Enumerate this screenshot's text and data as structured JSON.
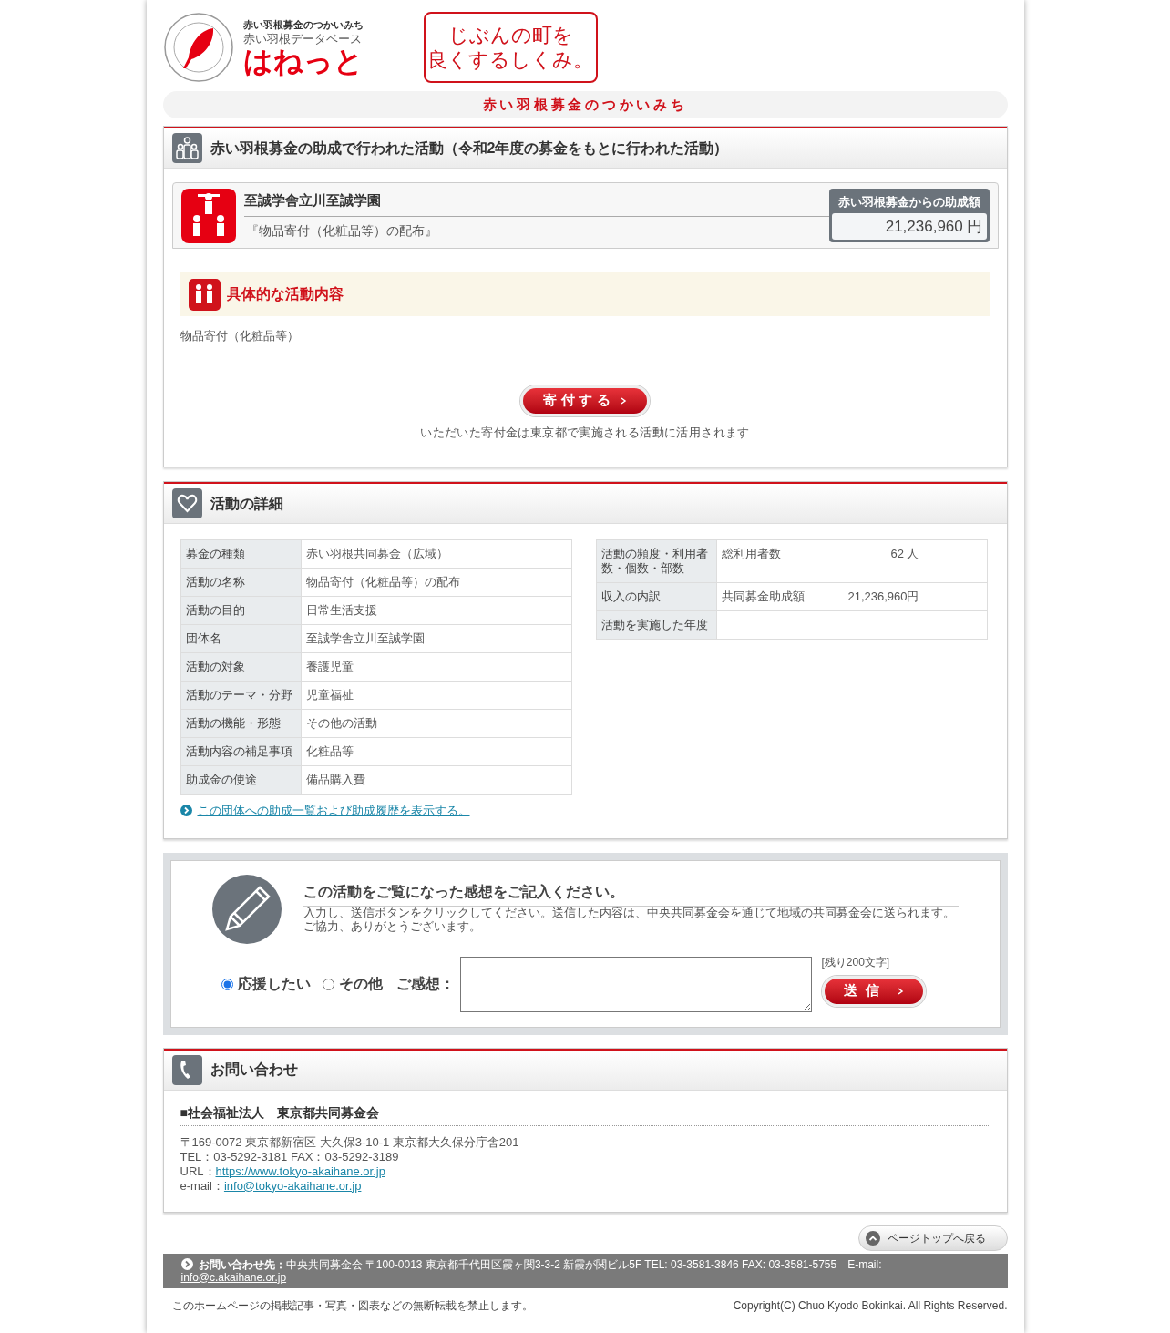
{
  "header": {
    "logo_caption": "赤い羽根募金のつかいみち",
    "logo_subtitle": "赤い羽根データベース",
    "logo_name": "はねっと",
    "slogan": [
      "じぶんの町を",
      "良くするしくみ。"
    ]
  },
  "banner": "赤い羽根募金のつかいみち",
  "activity": {
    "title": "赤い羽根募金の助成で行われた活動（令和2年度の募金をもとに行われた活動）",
    "org_name": "至誠学舎立川至誠学園",
    "activity_name": "『物品寄付（化粧品等）の配布』",
    "grant_label": "赤い羽根募金からの助成額",
    "grant_amount": "21,236,960 円",
    "detail_heading": "具体的な活動内容",
    "detail_text": "物品寄付（化粧品等）",
    "donate_button": "寄付する",
    "donate_note": "いただいた寄付金は東京都で実施される活動に活用されます"
  },
  "details": {
    "title": "活動の詳細",
    "left_table": [
      {
        "label": "募金の種類",
        "value": "赤い羽根共同募金（広域）"
      },
      {
        "label": "活動の名称",
        "value": "物品寄付（化粧品等）の配布"
      },
      {
        "label": "活動の目的",
        "value": "日常生活支援"
      },
      {
        "label": "団体名",
        "value": "至誠学舎立川至誠学園"
      },
      {
        "label": "活動の対象",
        "value": "養護児童"
      },
      {
        "label": "活動のテーマ・分野",
        "value": "児童福祉"
      },
      {
        "label": "活動の機能・形態",
        "value": "その他の活動"
      },
      {
        "label": "活動内容の補足事項",
        "value": "化粧品等"
      },
      {
        "label": "助成金の使途",
        "value": "備品購入費"
      }
    ],
    "right_table": [
      {
        "label": "活動の頻度・利用者数・個数・部数",
        "item": "総利用者数",
        "value": "62 人"
      },
      {
        "label": "収入の内訳",
        "item": "共同募金助成額",
        "value": "21,236,960円"
      },
      {
        "label": "活動を実施した年度"
      }
    ],
    "link": "この団体への助成一覧および助成履歴を表示する。"
  },
  "feedback": {
    "title": "この活動をご覧になった感想をご記入ください。",
    "instructions": [
      "入力し、送信ボタンをクリックしてください。送信した内容は、中央共同募金会を通じて地域の共同募金会に送られます。",
      "ご協力、ありがとうございます。"
    ],
    "options": [
      {
        "label": "応援したい",
        "selected": true
      },
      {
        "label": "その他",
        "selected": false
      }
    ],
    "comment_label": "ご感想：",
    "remaining": "[残り200文字]",
    "submit": "送信"
  },
  "contact": {
    "title": "お問い合わせ",
    "org": "■社会福祉法人　東京都共同募金会",
    "address": "〒169-0072 東京都新宿区 大久保3-10-1 東京都大久保分庁舎201",
    "phone": "TEL：03-5292-3181 FAX：03-5292-3189",
    "url_label": "URL：",
    "url": "https://www.tokyo-akaihane.or.jp",
    "email_label": "e-mail：",
    "email": "info@tokyo-akaihane.or.jp"
  },
  "page_top": "ページトップへ戻る",
  "footer": {
    "label": "お問い合わせ先：",
    "text": "中央共同募金会 〒100-0013 東京都千代田区霞ヶ関3-3-2 新霞が関ビル5F TEL: 03-3581-3846 FAX: 03-3581-5755　E-mail:",
    "email": "info@c.akaihane.or.jp",
    "notice": "このホームページの掲載記事・写真・図表などの無断転載を禁止します。",
    "copyright": "Copyright(C) Chuo Kyodo Bokinkai. All Rights Reserved."
  }
}
